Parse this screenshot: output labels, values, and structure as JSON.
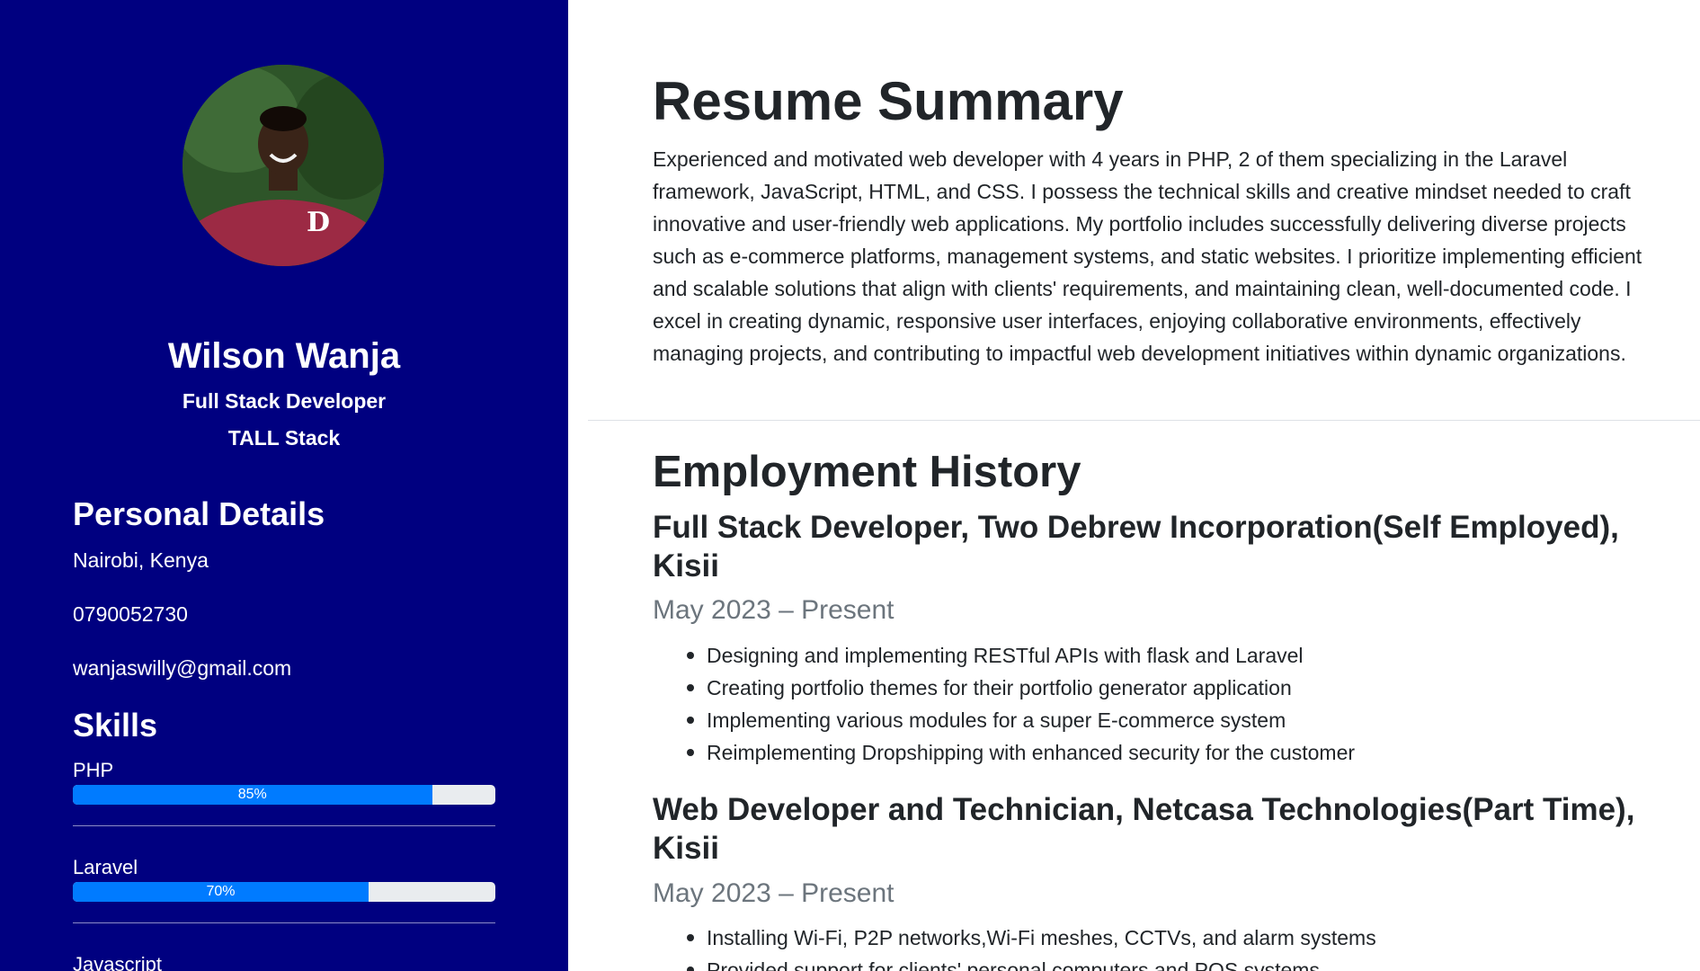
{
  "profile": {
    "name": "Wilson Wanja",
    "role": "Full Stack Developer",
    "stack": "TALL Stack"
  },
  "personal_details": {
    "heading": "Personal Details",
    "location": "Nairobi, Kenya",
    "phone": "0790052730",
    "email": "wanjaswilly@gmail.com"
  },
  "skills": {
    "heading": "Skills",
    "items": [
      {
        "name": "PHP",
        "percent_label": "85%",
        "level": 85
      },
      {
        "name": "Laravel",
        "percent_label": "70%",
        "level": 70
      },
      {
        "name": "Javascript",
        "percent_label": "",
        "level": 0
      }
    ]
  },
  "colors": {
    "sidebar_bg": "#000080",
    "progress_fill": "#007bff",
    "progress_track": "#e9ecef",
    "muted_text": "#6c757d"
  },
  "summary": {
    "heading": "Resume Summary",
    "text": "Experienced and motivated web developer with 4 years in PHP, 2 of them specializing in the Laravel framework, JavaScript, HTML, and CSS. I possess the technical skills and creative mindset needed to craft innovative and user-friendly web applications. My portfolio includes successfully delivering diverse projects such as e-commerce platforms, management systems, and static websites.  I prioritize implementing efficient and scalable solutions that align with clients' requirements, and maintaining clean, well-documented code. I excel in creating dynamic, responsive user interfaces,  enjoying collaborative environments, effectively managing projects, and contributing to impactful web development initiatives within dynamic organizations."
  },
  "employment": {
    "heading": "Employment History",
    "jobs": [
      {
        "title": "Full Stack Developer, Two Debrew Incorporation(Self Employed), Kisii",
        "dates": "May 2023 – Present",
        "duties": [
          "Designing and implementing RESTful APIs with flask and Laravel",
          "Creating portfolio themes for their portfolio generator application",
          "Implementing various modules for a super E-commerce system",
          "Reimplementing Dropshipping with enhanced security for the customer"
        ]
      },
      {
        "title": "Web Developer and Technician, Netcasa Technologies(Part Time), Kisii",
        "dates": "May 2023 – Present",
        "duties": [
          "Installing Wi-Fi, P2P networks,Wi-Fi meshes, CCTVs, and alarm systems",
          "Provided support for clients' personal computers and POS systems"
        ]
      }
    ]
  }
}
